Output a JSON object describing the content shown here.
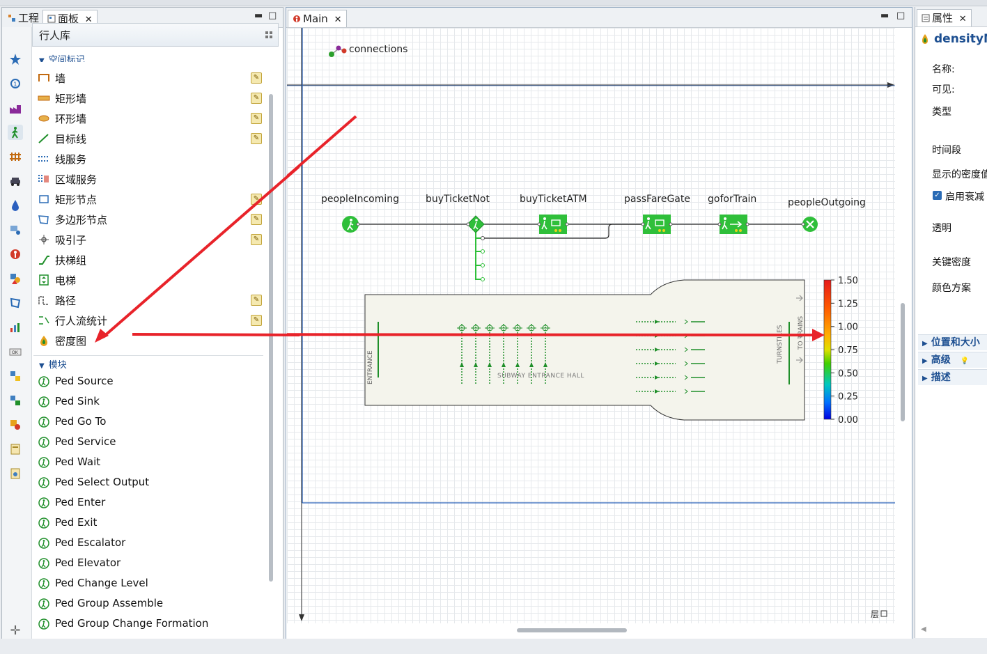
{
  "left_panel": {
    "tabs": [
      {
        "label": "工程"
      },
      {
        "label": "面板"
      }
    ],
    "library_title": "行人库",
    "space_section_label": "空间标记",
    "space_items": [
      {
        "label": "墙",
        "icon": "wall-icon",
        "editable": true
      },
      {
        "label": "矩形墙",
        "icon": "rect-wall-icon",
        "editable": true
      },
      {
        "label": "环形墙",
        "icon": "ring-wall-icon",
        "editable": true
      },
      {
        "label": "目标线",
        "icon": "target-line-icon",
        "editable": true
      },
      {
        "label": "线服务",
        "icon": "line-service-icon",
        "editable": false
      },
      {
        "label": "区域服务",
        "icon": "area-service-icon",
        "editable": false
      },
      {
        "label": "矩形节点",
        "icon": "rect-node-icon",
        "editable": true
      },
      {
        "label": "多边形节点",
        "icon": "polygon-node-icon",
        "editable": true
      },
      {
        "label": "吸引子",
        "icon": "attractor-icon",
        "editable": true
      },
      {
        "label": "扶梯组",
        "icon": "escalator-group-icon",
        "editable": false
      },
      {
        "label": "电梯",
        "icon": "elevator-icon",
        "editable": false
      },
      {
        "label": "路径",
        "icon": "path-icon",
        "editable": true
      },
      {
        "label": "行人流统计",
        "icon": "flow-stat-icon",
        "editable": true
      },
      {
        "label": "密度图",
        "icon": "density-map-icon",
        "editable": false
      }
    ],
    "modules_section_label": "模块",
    "module_items": [
      {
        "label": "Ped Source",
        "icon": "ped-source-icon"
      },
      {
        "label": "Ped Sink",
        "icon": "ped-sink-icon"
      },
      {
        "label": "Ped Go To",
        "icon": "ped-goto-icon"
      },
      {
        "label": "Ped Service",
        "icon": "ped-service-icon"
      },
      {
        "label": "Ped Wait",
        "icon": "ped-wait-icon"
      },
      {
        "label": "Ped Select Output",
        "icon": "ped-select-output-icon"
      },
      {
        "label": "Ped Enter",
        "icon": "ped-enter-icon"
      },
      {
        "label": "Ped Exit",
        "icon": "ped-exit-icon"
      },
      {
        "label": "Ped Escalator",
        "icon": "ped-escalator-icon"
      },
      {
        "label": "Ped Elevator",
        "icon": "ped-elevator-icon"
      },
      {
        "label": "Ped Change Level",
        "icon": "ped-change-level-icon"
      },
      {
        "label": "Ped Group Assemble",
        "icon": "ped-group-assemble-icon"
      },
      {
        "label": "Ped Group Change Formation",
        "icon": "ped-group-formation-icon"
      }
    ]
  },
  "editor": {
    "tab_label": "Main",
    "connections_label": "connections",
    "blocks": [
      {
        "name": "peopleIncoming"
      },
      {
        "name": "buyTicketNot"
      },
      {
        "name": "buyTicketATM"
      },
      {
        "name": "passFareGate"
      },
      {
        "name": "goforTrain"
      },
      {
        "name": "peopleOutgoing"
      }
    ],
    "hall_labels": {
      "entrance": "ENTRANCE",
      "hall": "SUBWAY ENTRANCE HALL",
      "turnstiles": "TURNSTILES",
      "to_trains": "TO TRAINS"
    },
    "legend_ticks": [
      "1.50",
      "1.25",
      "1.00",
      "0.75",
      "0.50",
      "0.25",
      "0.00"
    ],
    "layer_label": "层"
  },
  "right_panel": {
    "tab_label": "属性",
    "object_name": "densityM",
    "fields": [
      "名称:",
      "可见:",
      "类型",
      "时间段",
      "显示的密度值",
      "启用衰减",
      "透明",
      "关键密度",
      "颜色方案"
    ],
    "enable_decay_checked": true,
    "sections": [
      "位置和大小",
      "高级",
      "描述"
    ]
  },
  "colors": {
    "accent": "#1d4f91",
    "green": "#2fbf3a",
    "arrow_red": "#e8232a",
    "guide_blue": "#2b62b8"
  }
}
